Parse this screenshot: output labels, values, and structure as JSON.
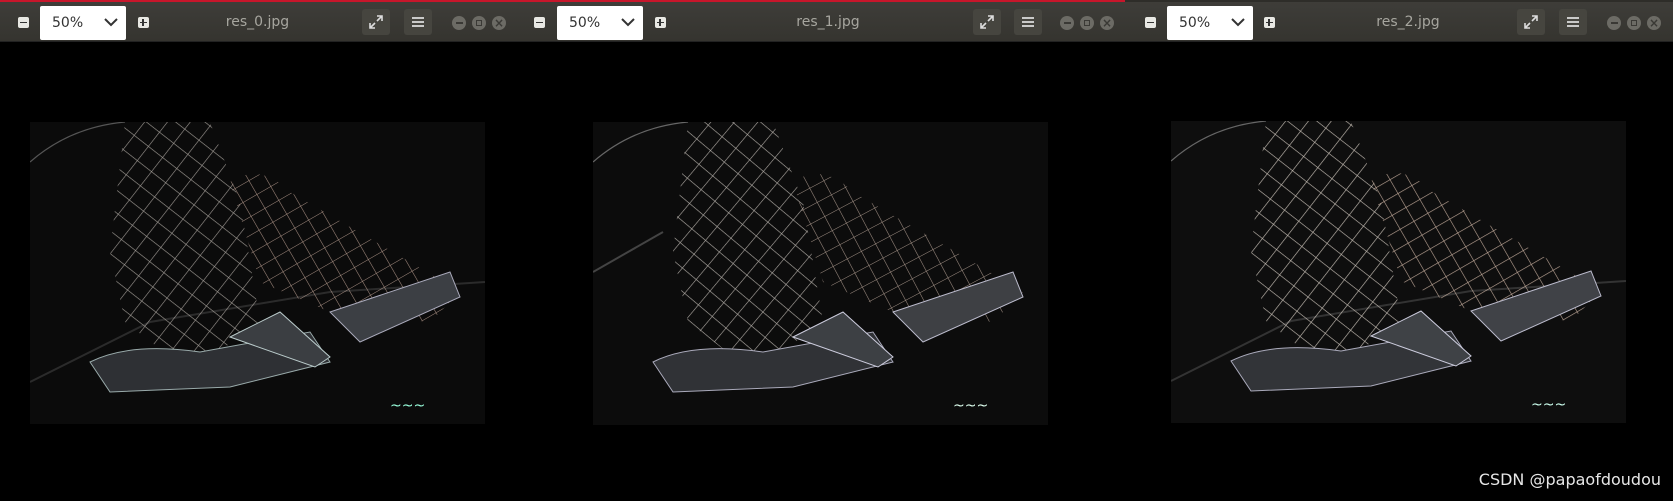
{
  "windows": [
    {
      "id": "res_0",
      "title": "res_0.jpg",
      "zoom": "50%"
    },
    {
      "id": "res_1",
      "title": "res_1.jpg",
      "zoom": "50%"
    },
    {
      "id": "res_2",
      "title": "res_2.jpg",
      "zoom": "50%"
    }
  ],
  "watermark": "CSDN @papaofdoudou",
  "colors": {
    "accent": "#c7162b",
    "titlebar": "#3a3935",
    "canvas": "#000000"
  },
  "icons": [
    "zoom-out-icon",
    "zoom-in-icon",
    "chevron-down-icon",
    "fullscreen-icon",
    "menu-icon",
    "minimize-icon",
    "maximize-icon",
    "close-icon"
  ]
}
